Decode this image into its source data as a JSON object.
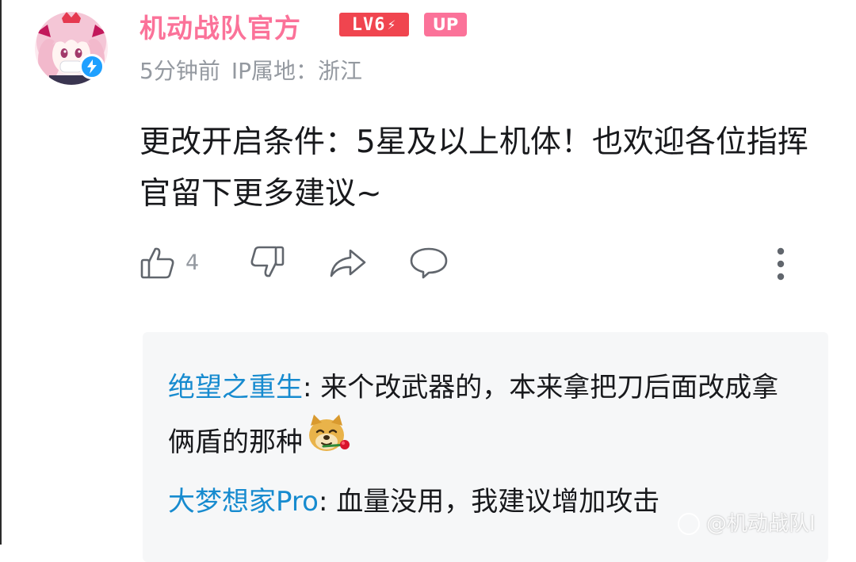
{
  "comment": {
    "username": "机动战队官方",
    "level_badge": "LV6",
    "up_badge": "UP",
    "time_ago": "5分钟前",
    "ip_location": "IP属地：浙江",
    "text": "更改开启条件：5星及以上机体！也欢迎各位指挥官留下更多建议~",
    "like_count": "4",
    "icons": {
      "avatar": "anime-girl-avatar",
      "verified": "lightning-verified-icon",
      "like": "thumbs-up-icon",
      "dislike": "thumbs-down-icon",
      "share": "share-arrow-icon",
      "reply": "comment-bubble-icon",
      "more": "more-vertical-icon"
    }
  },
  "replies": [
    {
      "user": "绝望之重生",
      "separator": ": ",
      "text": "来个改武器的，本来拿把刀后面改成拿俩盾的那种",
      "emoji": "doge-rose-emoji"
    },
    {
      "user": "大梦想家Pro",
      "separator": ": ",
      "text": "血量没用，我建议增加攻击"
    }
  ],
  "watermark": "@机动战队I",
  "colors": {
    "username_pink": "#fb7299",
    "level_red": "#f0454f",
    "meta_gray": "#9499a0",
    "reply_user_blue": "#178bcf",
    "reply_bg": "#f6f7f8",
    "verify_blue": "#1fa0ff"
  }
}
